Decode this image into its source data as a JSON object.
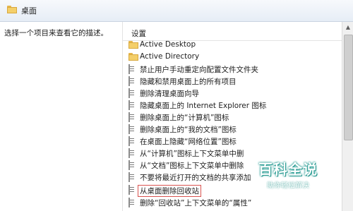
{
  "header": {
    "title": "桌面",
    "icon": "folder-icon"
  },
  "left_pane": {
    "description": "选择一个项目来查看它的描述。"
  },
  "right_pane": {
    "column_header": "设置",
    "items": [
      {
        "label": "Active Desktop",
        "icon": "folder-icon",
        "type": "folder"
      },
      {
        "label": "Active Directory",
        "icon": "folder-icon",
        "type": "folder"
      },
      {
        "label": "禁止用户手动重定向配置文件文件夹",
        "icon": "policy-icon",
        "type": "policy"
      },
      {
        "label": "隐藏和禁用桌面上的所有项目",
        "icon": "policy-icon",
        "type": "policy"
      },
      {
        "label": "删除清理桌面向导",
        "icon": "policy-icon",
        "type": "policy"
      },
      {
        "label": "隐藏桌面上的 Internet Explorer 图标",
        "icon": "policy-icon",
        "type": "policy"
      },
      {
        "label": "删除桌面上的“计算机”图标",
        "icon": "policy-icon",
        "type": "policy"
      },
      {
        "label": "删除桌面上的“我的文档”图标",
        "icon": "policy-icon",
        "type": "policy"
      },
      {
        "label": "在桌面上隐藏“网络位置”图标",
        "icon": "policy-icon",
        "type": "policy"
      },
      {
        "label": "从“计算机”图标上下文菜单中删",
        "icon": "policy-icon",
        "type": "policy"
      },
      {
        "label": "从“文档”图标上下文菜单中删除",
        "icon": "policy-icon",
        "type": "policy"
      },
      {
        "label": "不要将最近打开的文档的共享添加",
        "icon": "policy-icon",
        "type": "policy"
      },
      {
        "label": "从桌面删除回收站",
        "icon": "policy-icon",
        "type": "policy",
        "selected": true
      },
      {
        "label": "删除“回收站”上下文菜单的“属性”",
        "icon": "policy-icon",
        "type": "policy"
      }
    ]
  },
  "watermark": {
    "main": "百科全说",
    "sub": "助你轻松解决"
  },
  "colors": {
    "header_bg": "#e6edf6",
    "selection_border": "#d9534f",
    "folder": "#f4cf6a",
    "watermark_glow": "#2aa198"
  }
}
